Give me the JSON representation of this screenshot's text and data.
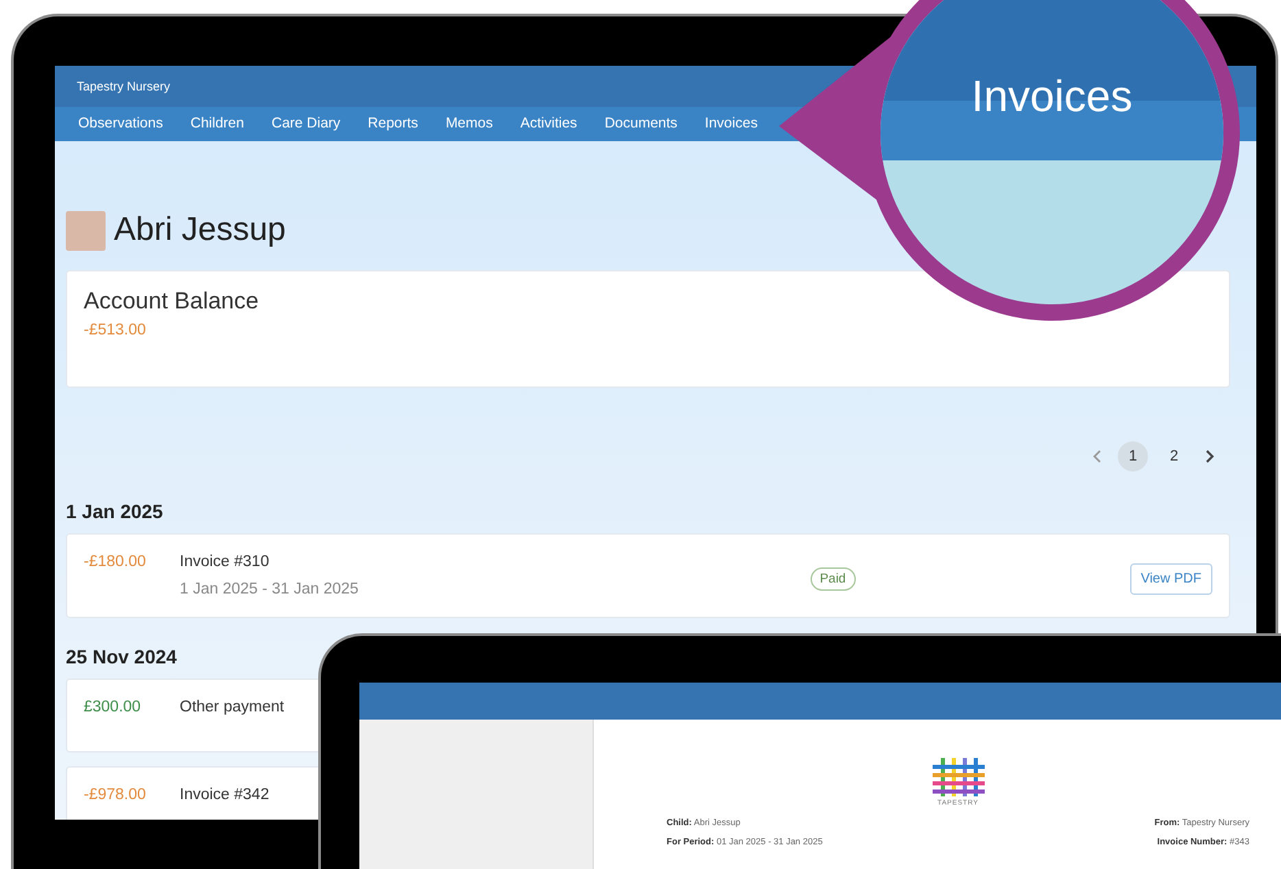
{
  "app": {
    "title": "Tapestry Nursery",
    "nav": [
      {
        "label": "Observations",
        "selected": false
      },
      {
        "label": "Children",
        "selected": false
      },
      {
        "label": "Care Diary",
        "selected": false
      },
      {
        "label": "Reports",
        "selected": false
      },
      {
        "label": "Memos",
        "selected": false
      },
      {
        "label": "Activities",
        "selected": false
      },
      {
        "label": "Documents",
        "selected": false
      },
      {
        "label": "Invoices",
        "selected": false
      }
    ]
  },
  "child": {
    "name": "Abri Jessup"
  },
  "balance": {
    "title": "Account Balance",
    "amount": "-£513.00",
    "kind": "debit"
  },
  "pagination": {
    "pages": [
      {
        "label": "1",
        "selected": true
      },
      {
        "label": "2",
        "selected": false
      }
    ]
  },
  "groups": [
    {
      "date": "1 Jan 2025",
      "entries": [
        {
          "amount": "-£180.00",
          "kind": "debit",
          "title": "Invoice #310",
          "period": "1 Jan 2025 - 31 Jan 2025",
          "status": "Paid",
          "action": "View PDF"
        }
      ]
    },
    {
      "date": "25 Nov 2024",
      "entries": [
        {
          "amount": "£300.00",
          "kind": "credit",
          "title": "Other payment"
        },
        {
          "amount": "-£978.00",
          "kind": "debit",
          "title": "Invoice #342"
        }
      ]
    }
  ],
  "callout": {
    "label": "Invoices"
  },
  "invoice_document": {
    "logo": "TAPESTRY",
    "left": [
      "**Child:** Abri Jessup",
      "**For Period:** 01 Jan 2025 - 31 Jan 2025"
    ],
    "right": [
      "**From:** Tapestry Nursery",
      "**Invoice Number:** #343"
    ]
  }
}
